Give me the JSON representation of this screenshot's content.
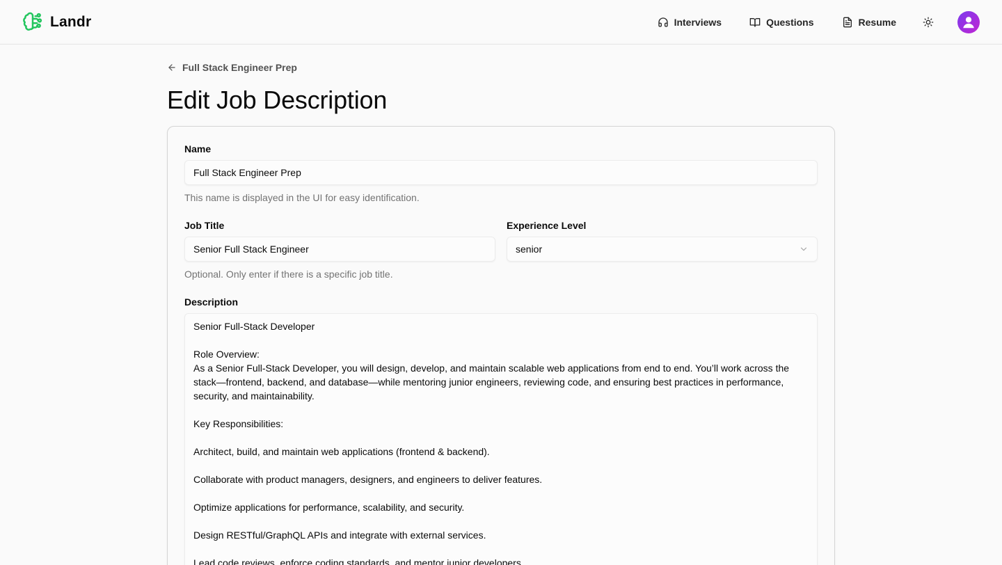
{
  "header": {
    "brand": "Landr",
    "nav": [
      {
        "label": "Interviews",
        "icon": "headset-icon"
      },
      {
        "label": "Questions",
        "icon": "book-open-icon"
      },
      {
        "label": "Resume",
        "icon": "file-text-icon"
      }
    ],
    "theme_icon": "sun-icon",
    "avatar_icon": "user-icon"
  },
  "colors": {
    "brand_accent": "#22c55e",
    "avatar": "#a021e8"
  },
  "breadcrumb": {
    "back_label": "Full Stack Engineer Prep"
  },
  "page_title": "Edit Job Description",
  "form": {
    "name": {
      "label": "Name",
      "value": "Full Stack Engineer Prep",
      "hint": "This name is displayed in the UI for easy identification."
    },
    "job_title": {
      "label": "Job Title",
      "value": "Senior Full Stack Engineer",
      "hint": "Optional. Only enter if there is a specific job title."
    },
    "experience_level": {
      "label": "Experience Level",
      "value": "senior"
    },
    "description": {
      "label": "Description",
      "value": "Senior Full-Stack Developer\n\nRole Overview:\nAs a Senior Full-Stack Developer, you will design, develop, and maintain scalable web applications from end to end. You’ll work across the stack—frontend, backend, and database—while mentoring junior engineers, reviewing code, and ensuring best practices in performance, security, and maintainability.\n\nKey Responsibilities:\n\nArchitect, build, and maintain web applications (frontend & backend).\n\nCollaborate with product managers, designers, and engineers to deliver features.\n\nOptimize applications for performance, scalability, and security.\n\nDesign RESTful/GraphQL APIs and integrate with external services.\n\nLead code reviews, enforce coding standards, and mentor junior developers."
    }
  }
}
